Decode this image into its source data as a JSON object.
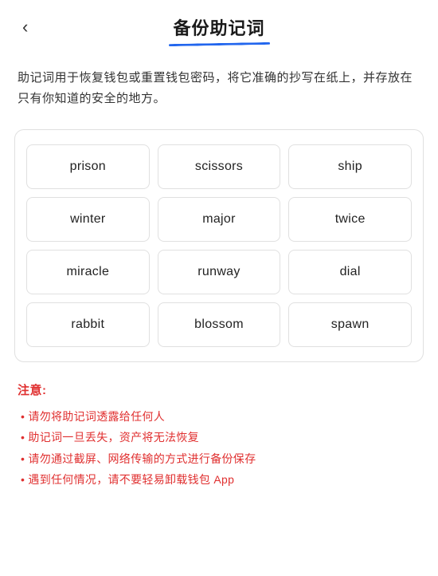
{
  "header": {
    "back_label": "‹",
    "title": "备份助记词"
  },
  "description": "助记词用于恢复钱包或重置钱包密码，将它准确的抄写在纸上，并存放在只有你知道的安全的地方。",
  "mnemonic": {
    "words": [
      "prison",
      "scissors",
      "ship",
      "winter",
      "major",
      "twice",
      "miracle",
      "runway",
      "dial",
      "rabbit",
      "blossom",
      "spawn"
    ]
  },
  "notice": {
    "title": "注意:",
    "items": [
      "请勿将助记词透露给任何人",
      "助记词一旦丢失，资产将无法恢复",
      "请勿通过截屏、网络传输的方式进行备份保存",
      "遇到任何情况，请不要轻易卸载钱包 App"
    ]
  }
}
